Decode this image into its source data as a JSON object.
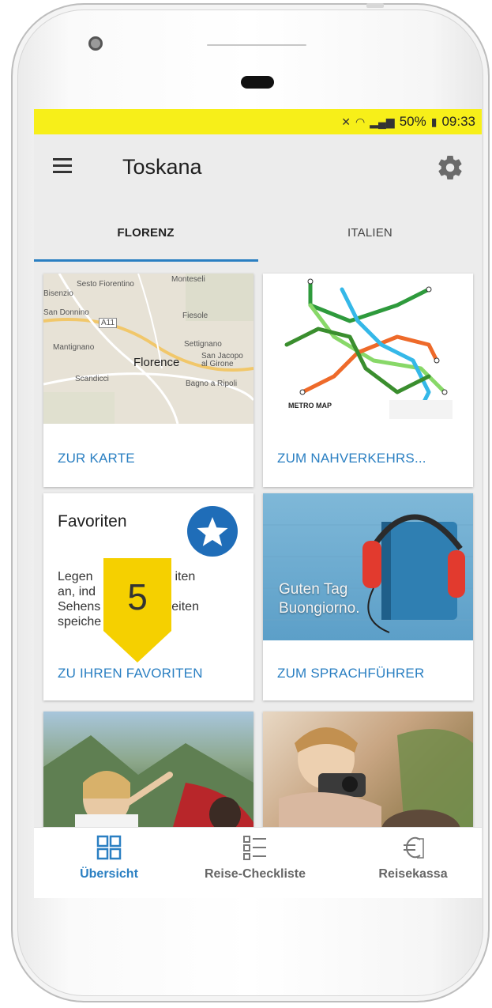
{
  "status_bar": {
    "battery": "50%",
    "time": "09:33"
  },
  "app_bar": {
    "title": "Toskana"
  },
  "tabs": [
    {
      "label": "FLORENZ",
      "active": true
    },
    {
      "label": "ITALIEN",
      "active": false
    }
  ],
  "cards": {
    "map": {
      "labels": [
        "Sesto Fiorentino",
        "Bisenzio",
        "Monteseli",
        "San Donnino",
        "Fiesole",
        "A11",
        "Mantignano",
        "Florence",
        "Settignano",
        "San Jacopo al Girone",
        "Scandicci",
        "Bagno a Ripoli"
      ],
      "link": "ZUR KARTE"
    },
    "metro": {
      "caption": "METRO MAP",
      "link": "ZUM NAHVERKEHRS..."
    },
    "favorites": {
      "title": "Favoriten",
      "body_lines": [
        "Legen",
        "an, ind",
        "Sehens",
        "speiche"
      ],
      "body_tail": [
        "iten",
        "",
        "eiten",
        ""
      ],
      "link": "ZU IHREN FAVORITEN"
    },
    "phrasebook": {
      "image_text_1": "Guten Tag",
      "image_text_2": "Buongiorno.",
      "link": "ZUM SPRACHFÜHRER"
    }
  },
  "callout": {
    "number": "5"
  },
  "bottom_nav": [
    {
      "label": "Übersicht",
      "icon": "grid-icon",
      "active": true
    },
    {
      "label": "Reise-Checkliste",
      "icon": "checklist-icon",
      "active": false
    },
    {
      "label": "Reisekassa",
      "icon": "euro-icon",
      "active": false
    }
  ],
  "colors": {
    "status_bar": "#f7ef19",
    "accent": "#2a7fc2",
    "callout": "#f5d000",
    "star_badge": "#1f6db8"
  }
}
